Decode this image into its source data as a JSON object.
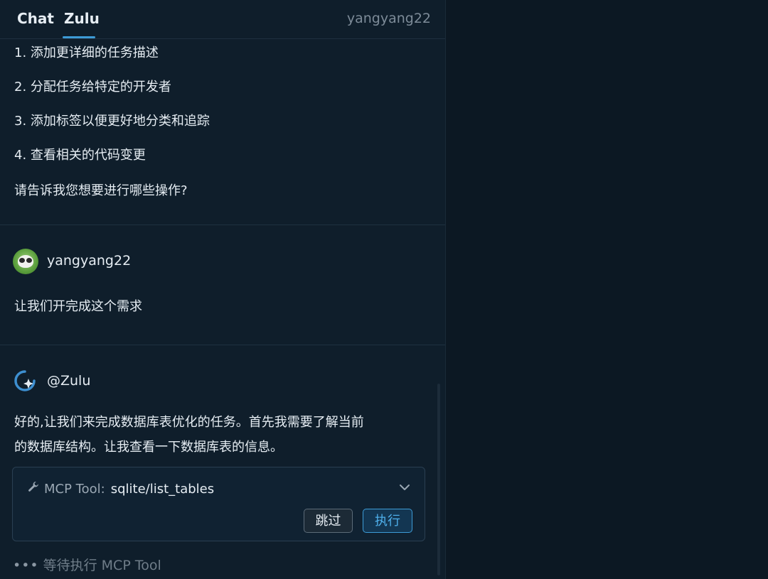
{
  "header": {
    "tabs": [
      {
        "label": "Chat"
      },
      {
        "label": "Zulu"
      }
    ],
    "user": "yangyang22"
  },
  "assistant_prev": {
    "lines": [
      "1. 添加更详细的任务描述",
      "2. 分配任务给特定的开发者",
      "3. 添加标签以便更好地分类和追踪",
      "4. 查看相关的代码变更",
      "请告诉我您想要进行哪些操作?"
    ]
  },
  "user_message": {
    "username": "yangyang22",
    "text": "让我们开完成这个需求"
  },
  "zulu_message": {
    "name": "@Zulu",
    "lines": [
      "好的,让我们来完成数据库表优化的任务。首先我需要了解当前",
      "的数据库结构。让我查看一下数据库表的信息。"
    ],
    "tool": {
      "label": "MCP Tool:",
      "name": "sqlite/list_tables",
      "skip_label": "跳过",
      "run_label": "执行"
    },
    "status": "等待执行 MCP Tool"
  },
  "colors": {
    "accent": "#3d9bd6",
    "background": "#0f1e2b"
  }
}
